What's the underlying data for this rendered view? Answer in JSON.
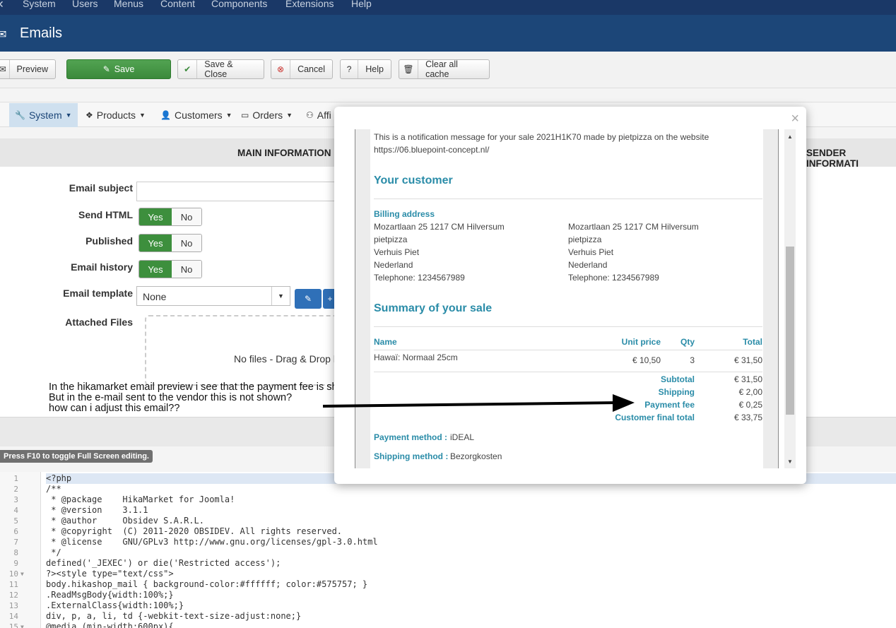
{
  "menubar": {
    "items": [
      "System",
      "Users",
      "Menus",
      "Content",
      "Components",
      "Extensions",
      "Help"
    ]
  },
  "header": {
    "title": "Emails"
  },
  "toolbar": {
    "preview": "Preview",
    "save": "Save",
    "save_close": "Save & Close",
    "cancel": "Cancel",
    "help": "Help",
    "clear_cache": "Clear all cache"
  },
  "nav": {
    "items": [
      "System",
      "Products",
      "Customers",
      "Orders",
      "Affi"
    ]
  },
  "sections": {
    "main": "MAIN INFORMATION",
    "sender": "SENDER INFORMATI"
  },
  "form": {
    "email_subject": "Email subject",
    "send_html": "Send HTML",
    "published": "Published",
    "email_history": "Email history",
    "email_template": "Email template",
    "template_value": "None",
    "attached_files": "Attached Files",
    "dropzone": "No files - Drag & Drop he",
    "yes": "Yes",
    "no": "No"
  },
  "annotation": [
    "In the hikamarket email preview i see that the payment fee is shown?",
    "But in the e-mail sent to the vendor this is not shown?",
    "how can i adjust this email??"
  ],
  "editor_hint": "Press F10 to toggle Full Screen editing.",
  "code": {
    "lines": [
      {
        "n": "1",
        "text": "<?php"
      },
      {
        "n": "2",
        "text": "/**"
      },
      {
        "n": "3",
        "text": " * @package    HikaMarket for Joomla!"
      },
      {
        "n": "4",
        "text": " * @version    3.1.1"
      },
      {
        "n": "5",
        "text": " * @author     Obsidev S.A.R.L."
      },
      {
        "n": "6",
        "text": " * @copyright  (C) 2011-2020 OBSIDEV. All rights reserved."
      },
      {
        "n": "7",
        "text": " * @license    GNU/GPLv3 http://www.gnu.org/licenses/gpl-3.0.html"
      },
      {
        "n": "8",
        "text": " */"
      },
      {
        "n": "9",
        "text": "defined('_JEXEC') or die('Restricted access');"
      },
      {
        "n": "10",
        "text": "?><style type=\"text/css\">"
      },
      {
        "n": "11",
        "text": "body.hikashop_mail { background-color:#ffffff; color:#575757; }"
      },
      {
        "n": "12",
        "text": ".ReadMsgBody{width:100%;}"
      },
      {
        "n": "13",
        "text": ".ExternalClass{width:100%;}"
      },
      {
        "n": "14",
        "text": "div, p, a, li, td {-webkit-text-size-adjust:none;}"
      },
      {
        "n": "15",
        "text": "@media (min-width:600px){"
      }
    ]
  },
  "modal": {
    "close": "×",
    "intro_1": "This is a notification message for your sale 2021H1K70 made by pietpizza on the website",
    "intro_2": "https://06.bluepoint-concept.nl/",
    "customer_heading": "Your customer",
    "billing_label": "Billing address",
    "address_left": [
      "Mozartlaan 25 1217 CM Hilversum",
      "pietpizza",
      "Verhuis Piet",
      "Nederland",
      "Telephone: 1234567989"
    ],
    "address_right": [
      "Mozartlaan 25 1217 CM Hilversum",
      "pietpizza",
      "Verhuis Piet",
      "Nederland",
      "Telephone: 1234567989"
    ],
    "summary_heading": "Summary of your sale",
    "col_name": "Name",
    "col_unit": "Unit price",
    "col_qty": "Qty",
    "col_total": "Total",
    "item_name": "Hawaï: Normaal 25cm",
    "item_unit": "€ 10,50",
    "item_qty": "3",
    "item_total": "€ 31,50",
    "subtotal_label": "Subtotal",
    "subtotal": "€ 31,50",
    "shipping_label": "Shipping",
    "shipping": "€ 2,00",
    "payment_fee_label": "Payment fee",
    "payment_fee": "€ 0,25",
    "final_label": "Customer final total",
    "final": "€ 33,75",
    "payment_method_label": "Payment method :",
    "payment_method": "iDEAL",
    "shipping_method_label": "Shipping method :",
    "shipping_method": "Bezorgkosten"
  }
}
